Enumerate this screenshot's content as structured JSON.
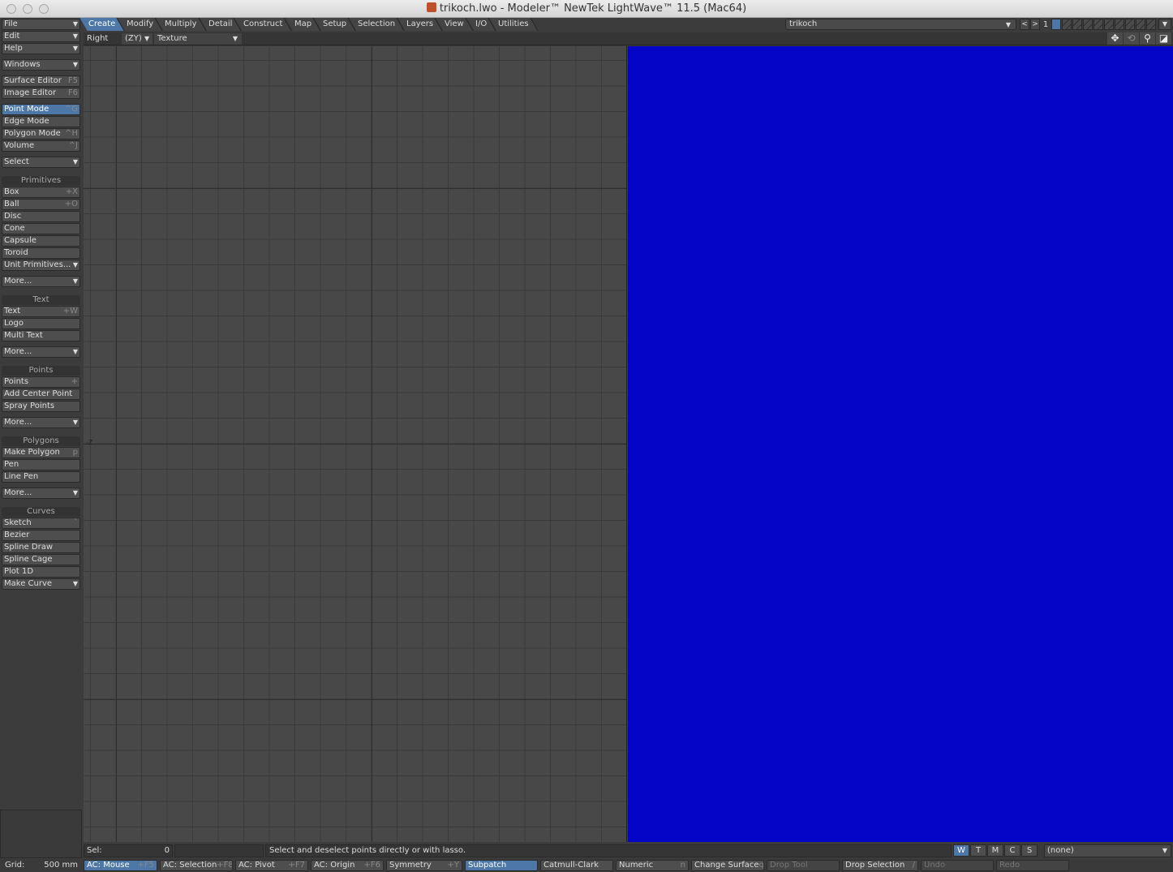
{
  "window": {
    "title": "trikoch.lwo - Modeler™ NewTek LightWave™ 11.5 (Mac64)"
  },
  "sidebar": {
    "menus": [
      {
        "label": "File"
      },
      {
        "label": "Edit"
      },
      {
        "label": "Help"
      }
    ],
    "windows": "Windows",
    "editors": [
      {
        "label": "Surface Editor",
        "shortcut": "F5"
      },
      {
        "label": "Image Editor",
        "shortcut": "F6"
      }
    ],
    "modes": [
      {
        "label": "Point Mode",
        "shortcut": "^G",
        "selected": true
      },
      {
        "label": "Edge Mode",
        "shortcut": ""
      },
      {
        "label": "Polygon Mode",
        "shortcut": "^H"
      },
      {
        "label": "Volume",
        "shortcut": "^J"
      }
    ],
    "select": "Select",
    "groups": [
      {
        "title": "Primitives",
        "items": [
          {
            "label": "Box",
            "shortcut": "+X"
          },
          {
            "label": "Ball",
            "shortcut": "+O"
          },
          {
            "label": "Disc",
            "shortcut": ""
          },
          {
            "label": "Cone",
            "shortcut": ""
          },
          {
            "label": "Capsule",
            "shortcut": ""
          },
          {
            "label": "Toroid",
            "shortcut": ""
          },
          {
            "label": "Unit Primitives...",
            "dropdown": true
          }
        ],
        "more": "More..."
      },
      {
        "title": "Text",
        "items": [
          {
            "label": "Text",
            "shortcut": "+W"
          },
          {
            "label": "Logo",
            "shortcut": ""
          },
          {
            "label": "Multi Text",
            "shortcut": ""
          }
        ],
        "more": "More..."
      },
      {
        "title": "Points",
        "items": [
          {
            "label": "Points",
            "shortcut": "+"
          },
          {
            "label": "Add Center Point",
            "shortcut": ""
          },
          {
            "label": "Spray Points",
            "shortcut": ""
          }
        ],
        "more": "More..."
      },
      {
        "title": "Polygons",
        "items": [
          {
            "label": "Make Polygon",
            "shortcut": "p"
          },
          {
            "label": "Pen",
            "shortcut": ""
          },
          {
            "label": "Line Pen",
            "shortcut": ""
          }
        ],
        "more": "More..."
      },
      {
        "title": "Curves",
        "items": [
          {
            "label": "Sketch",
            "shortcut": "`"
          },
          {
            "label": "Bezier",
            "shortcut": ""
          },
          {
            "label": "Spline Draw",
            "shortcut": ""
          },
          {
            "label": "Spline Cage",
            "shortcut": ""
          },
          {
            "label": "Plot 1D",
            "shortcut": ""
          },
          {
            "label": "Make Curve",
            "dropdown": true
          }
        ]
      }
    ]
  },
  "tabs": [
    {
      "label": "Create",
      "active": true
    },
    {
      "label": "Modify"
    },
    {
      "label": "Multiply"
    },
    {
      "label": "Detail"
    },
    {
      "label": "Construct"
    },
    {
      "label": "Map"
    },
    {
      "label": "Setup"
    },
    {
      "label": "Selection"
    },
    {
      "label": "Layers"
    },
    {
      "label": "View"
    },
    {
      "label": "I/O"
    },
    {
      "label": "Utilities"
    }
  ],
  "layers": {
    "object": "trikoch",
    "current": "1"
  },
  "viewport": {
    "view": "Right",
    "axes": "(ZY)",
    "render": "Texture",
    "axis_label": "-Z",
    "right_color": "#0505c8"
  },
  "status": {
    "sel_label": "Sel:",
    "sel_count": "0",
    "hint": "Select and deselect points directly or with lasso.",
    "wtmcs": [
      "W",
      "T",
      "M",
      "C",
      "S"
    ],
    "surface": "(none)"
  },
  "bottom": {
    "grid_label": "Grid:",
    "grid_value": "500 mm",
    "buttons": [
      {
        "label": "AC: Mouse",
        "shortcut": "+F5",
        "state": "sel"
      },
      {
        "label": "AC: Selection",
        "shortcut": "+F8"
      },
      {
        "label": "AC: Pivot",
        "shortcut": "+F7"
      },
      {
        "label": "AC: Origin",
        "shortcut": "+F6"
      },
      {
        "label": "Symmetry",
        "shortcut": "+Y"
      },
      {
        "label": "Subpatch",
        "shortcut": "",
        "state": "sel"
      },
      {
        "label": "Catmull-Clark",
        "shortcut": ""
      },
      {
        "label": "Numeric",
        "shortcut": "n"
      },
      {
        "label": "Change Surface",
        "shortcut": "q"
      },
      {
        "label": "Drop Tool",
        "shortcut": "",
        "state": "dis"
      },
      {
        "label": "Drop Selection",
        "shortcut": "/"
      },
      {
        "label": "Undo",
        "shortcut": "",
        "state": "dis"
      },
      {
        "label": "Redo",
        "shortcut": "",
        "state": "dis"
      }
    ]
  },
  "accent": "#4d77a6"
}
